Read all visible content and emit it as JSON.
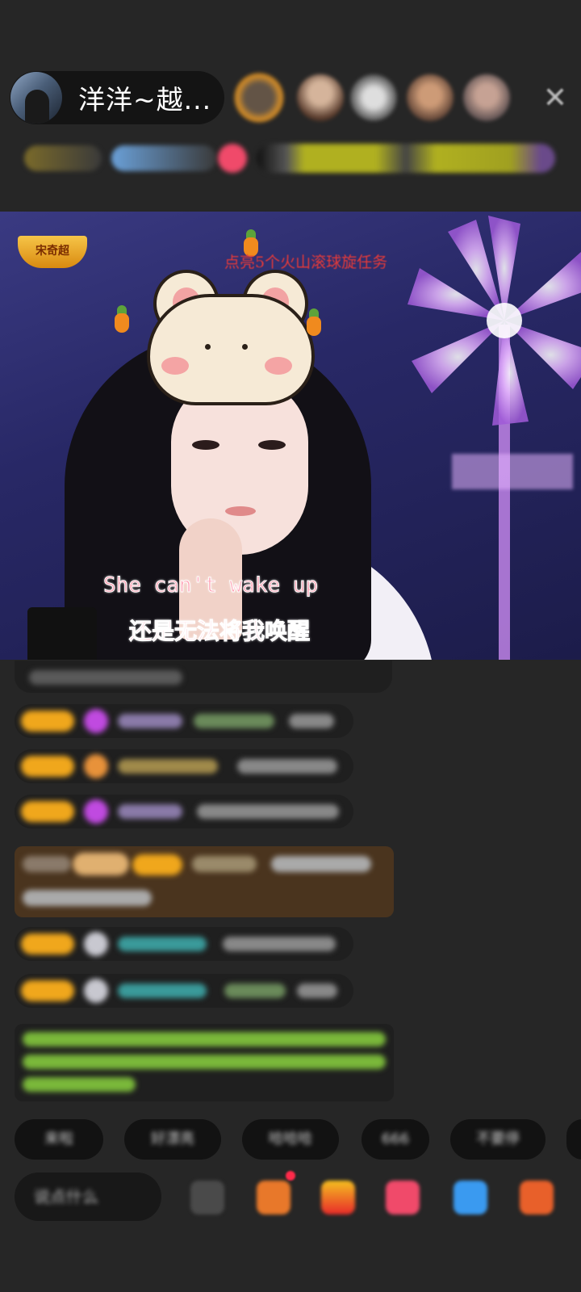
{
  "header": {
    "host_name": "洋洋~越...",
    "close_icon": "close-icon",
    "viewer_count": 5
  },
  "video": {
    "logo_badge": "宋奇超",
    "task_banner": "点亮5个火山滚球旋任务",
    "subtitle_en": "She can't wake up",
    "subtitle_zh": "还是无法将我唤醒"
  },
  "chat": {
    "messages": [
      {
        "user": "",
        "text": ""
      },
      {
        "user": "",
        "text": ""
      },
      {
        "user": "",
        "text": ""
      },
      {
        "user": "",
        "text": ""
      },
      {
        "user": "",
        "text": ""
      },
      {
        "user": "",
        "text": ""
      }
    ]
  },
  "quick_replies": [
    "来啦",
    "好漂亮",
    "哈哈哈",
    "666",
    "不要停"
  ],
  "bottom_bar": {
    "input_placeholder": "说点什么",
    "tools": [
      "emoji-icon",
      "gift-box-icon",
      "fries-icon",
      "heart-gift-icon",
      "game-icon",
      "more-icon"
    ]
  },
  "colors": {
    "background": "#262626",
    "level_badge": "#f0a71c",
    "task_text": "#e23a3a",
    "subtitle": "#ff8aa6"
  }
}
